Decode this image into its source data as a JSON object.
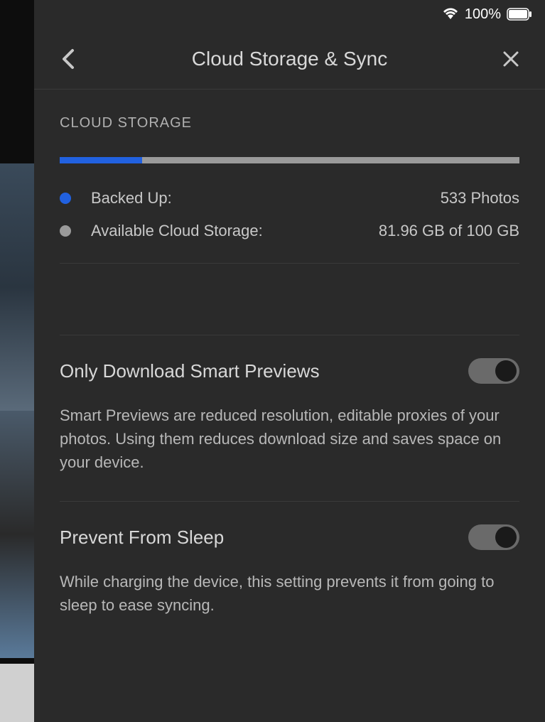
{
  "status_bar": {
    "battery_percent": "100%"
  },
  "header": {
    "title": "Cloud Storage & Sync"
  },
  "storage": {
    "section_label": "CLOUD STORAGE",
    "progress_percent": 18,
    "backed_up": {
      "label": "Backed Up:",
      "value": "533 Photos",
      "color": "#2161e0"
    },
    "available": {
      "label": "Available Cloud Storage:",
      "value": "81.96 GB of 100 GB",
      "color": "#9a9a9a"
    }
  },
  "settings": {
    "smart_previews": {
      "title": "Only Download Smart Previews",
      "description": "Smart Previews are reduced resolution, editable proxies of your photos. Using them reduces download size and saves space on your device.",
      "enabled": true
    },
    "prevent_sleep": {
      "title": "Prevent From Sleep",
      "description": "While charging the device, this setting prevents it from going to sleep to ease syncing.",
      "enabled": true
    }
  }
}
